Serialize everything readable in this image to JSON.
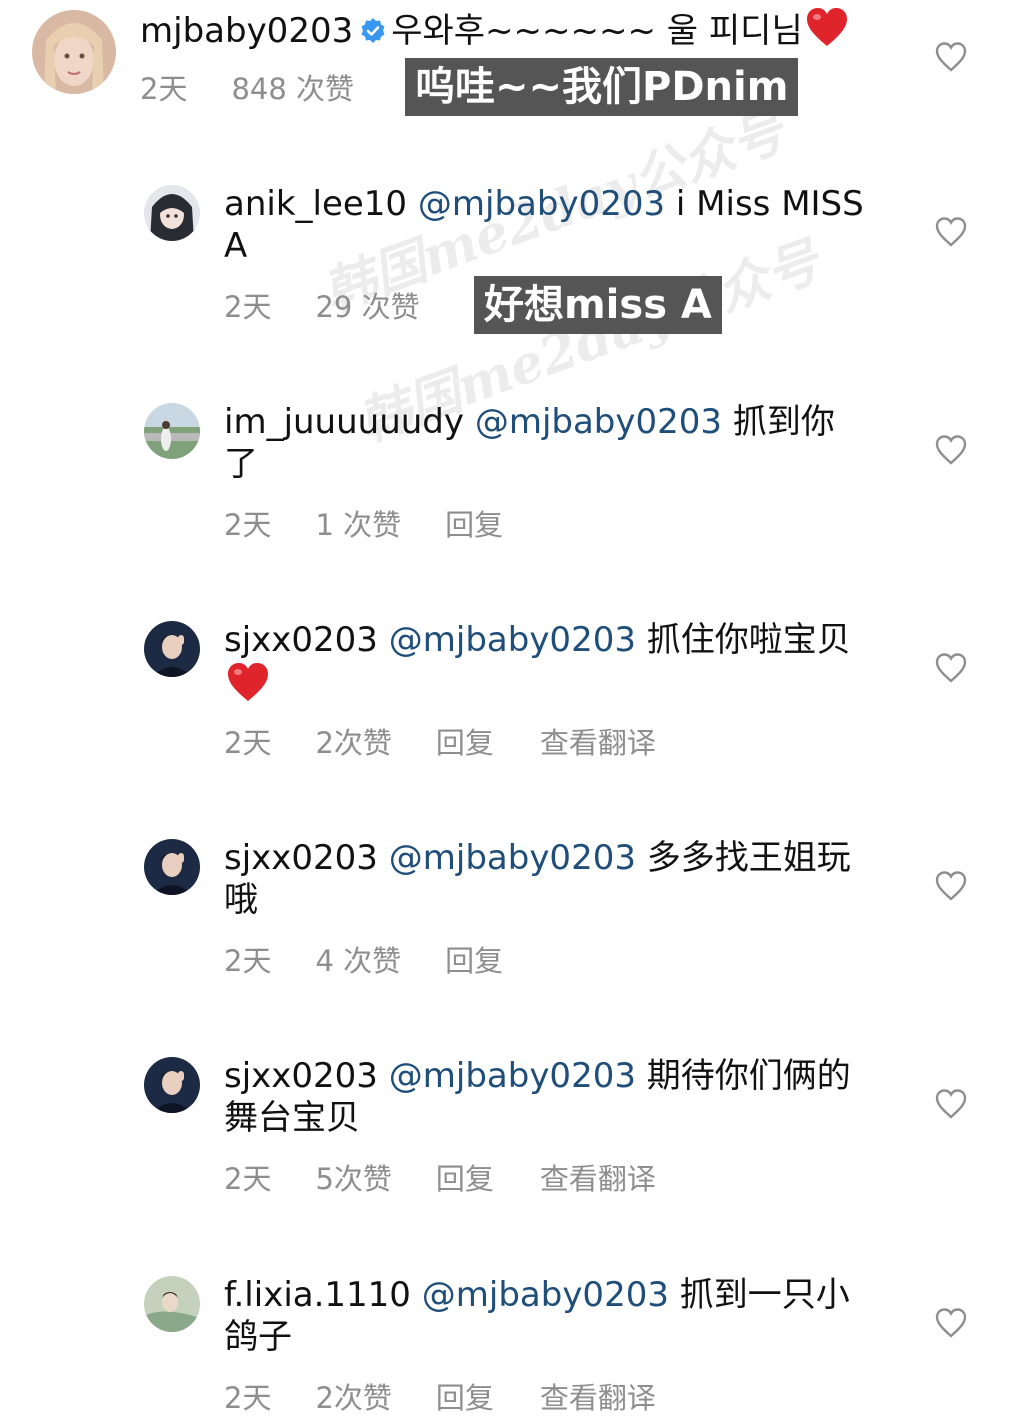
{
  "watermark": {
    "text_1": "韩国me2day公众号",
    "text_2": "韩国me2day公众号"
  },
  "colors": {
    "meta_gray": "#8e8e8e",
    "mention_blue": "#1f4e7a",
    "verified_blue": "#3897f0",
    "overlay_bg": "#555555",
    "heart_red": "#e0242c"
  },
  "comments": [
    {
      "username": "mjbaby0203",
      "verified": true,
      "mention": "",
      "text": "우와후~~~~~~ 울 피디님",
      "emoji": "red-heart",
      "time": "2天",
      "likes": "848 次赞",
      "reply": "",
      "translate": "",
      "overlay": "呜哇~~我们PDnim"
    },
    {
      "username": "anik_lee10",
      "verified": false,
      "mention": "@mjbaby0203",
      "text": "i Miss MISS A",
      "emoji": "",
      "time": "2天",
      "likes": "29 次赞",
      "reply": "",
      "translate": "",
      "overlay": "好想miss A"
    },
    {
      "username": "im_juuuuuudy",
      "verified": false,
      "mention": "@mjbaby0203",
      "text": "抓到你了",
      "emoji": "",
      "time": "2天",
      "likes": "1 次赞",
      "reply": "回复",
      "translate": "",
      "overlay": ""
    },
    {
      "username": "sjxx0203",
      "verified": false,
      "mention": "@mjbaby0203",
      "text": "抓住你啦宝贝",
      "emoji": "red-heart",
      "time": "2天",
      "likes": "2次赞",
      "reply": "回复",
      "translate": "查看翻译",
      "overlay": ""
    },
    {
      "username": "sjxx0203",
      "verified": false,
      "mention": "@mjbaby0203",
      "text": "多多找王姐玩哦",
      "emoji": "",
      "time": "2天",
      "likes": "4 次赞",
      "reply": "回复",
      "translate": "",
      "overlay": ""
    },
    {
      "username": "sjxx0203",
      "verified": false,
      "mention": "@mjbaby0203",
      "text": "期待你们俩的舞台宝贝",
      "emoji": "",
      "time": "2天",
      "likes": "5次赞",
      "reply": "回复",
      "translate": "查看翻译",
      "overlay": ""
    },
    {
      "username": "f.lixia.1110",
      "verified": false,
      "mention": "@mjbaby0203",
      "text": "抓到一只小鸽子",
      "emoji": "",
      "time": "2天",
      "likes": "2次赞",
      "reply": "回复",
      "translate": "查看翻译",
      "overlay": ""
    }
  ]
}
